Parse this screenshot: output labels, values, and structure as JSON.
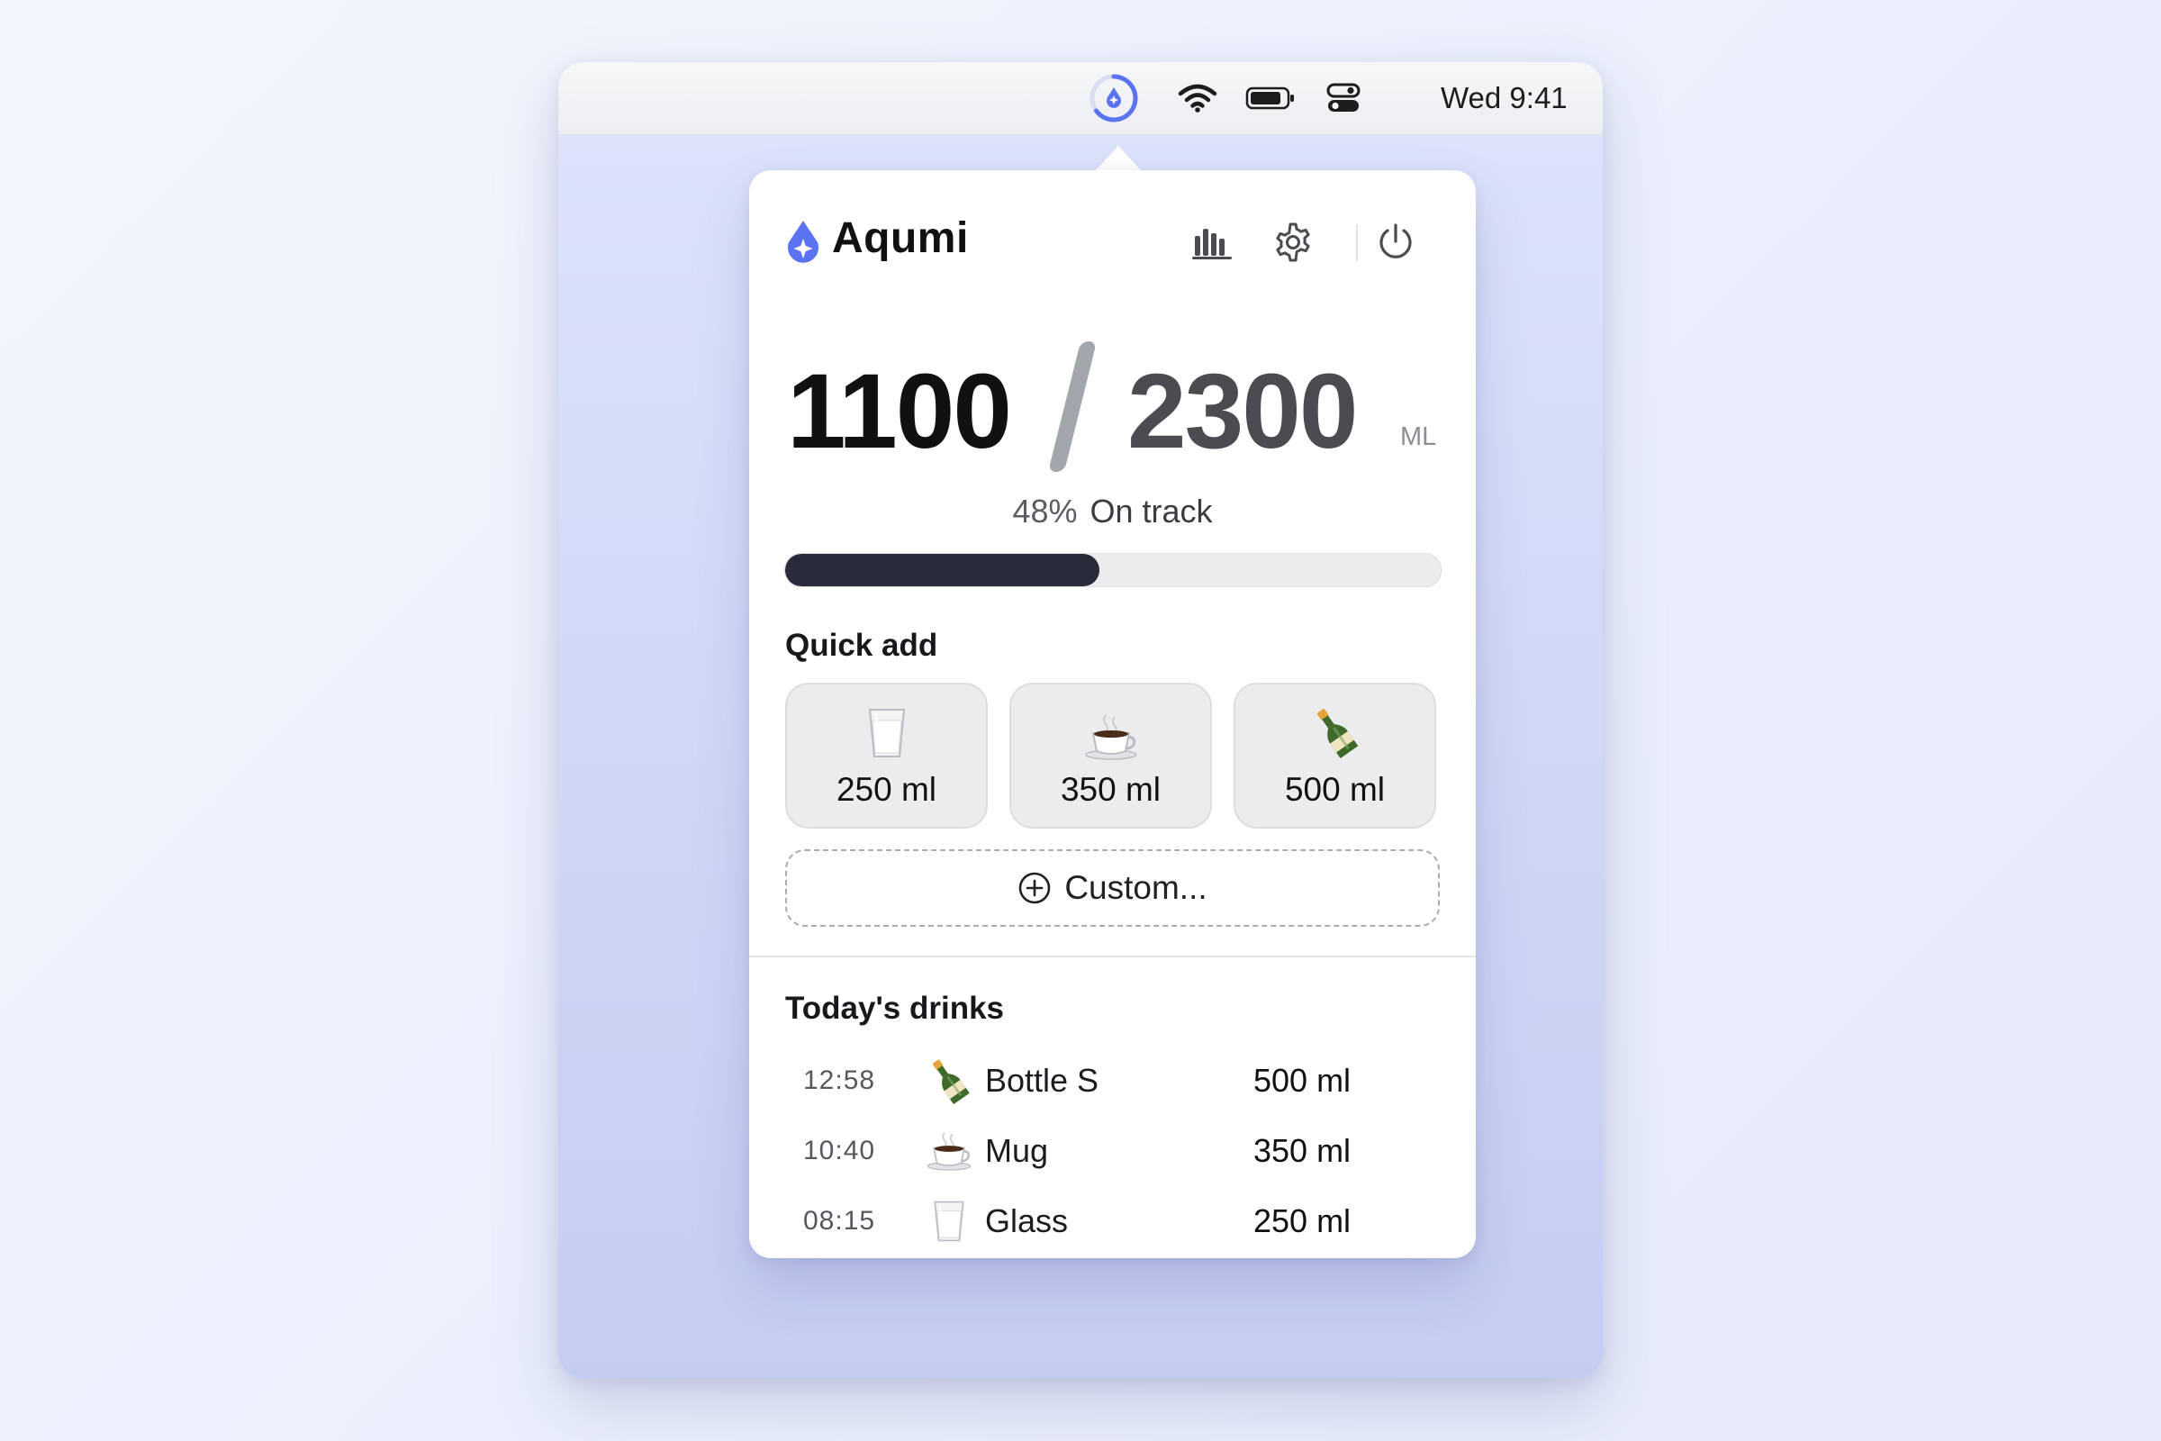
{
  "menubar": {
    "clock": "Wed 9:41",
    "icons": [
      "aqumi-drop-icon",
      "wifi-icon",
      "battery-icon",
      "control-center-icon"
    ]
  },
  "app": {
    "title": "Aqumi",
    "accent": "#5b73f0",
    "header_icons": [
      "stats-icon",
      "gear-icon",
      "power-icon"
    ]
  },
  "progress": {
    "current": "1100",
    "goal": "2300",
    "unit": "ML",
    "percent_label": "48%",
    "percent": 48,
    "status": "On track"
  },
  "quick_add": {
    "title": "Quick add",
    "buttons": [
      {
        "label": "250 ml",
        "icon": "glass-icon"
      },
      {
        "label": "350 ml",
        "icon": "mug-icon"
      },
      {
        "label": "500 ml",
        "icon": "bottle-icon"
      }
    ],
    "custom_label": "Custom..."
  },
  "today": {
    "title": "Today's drinks",
    "drinks": [
      {
        "time": "12:58",
        "name": "Bottle S",
        "amount": "500 ml",
        "icon": "bottle-icon"
      },
      {
        "time": "10:40",
        "name": "Mug",
        "amount": "350 ml",
        "icon": "mug-icon"
      },
      {
        "time": "08:15",
        "name": "Glass",
        "amount": "250 ml",
        "icon": "glass-icon"
      }
    ]
  }
}
